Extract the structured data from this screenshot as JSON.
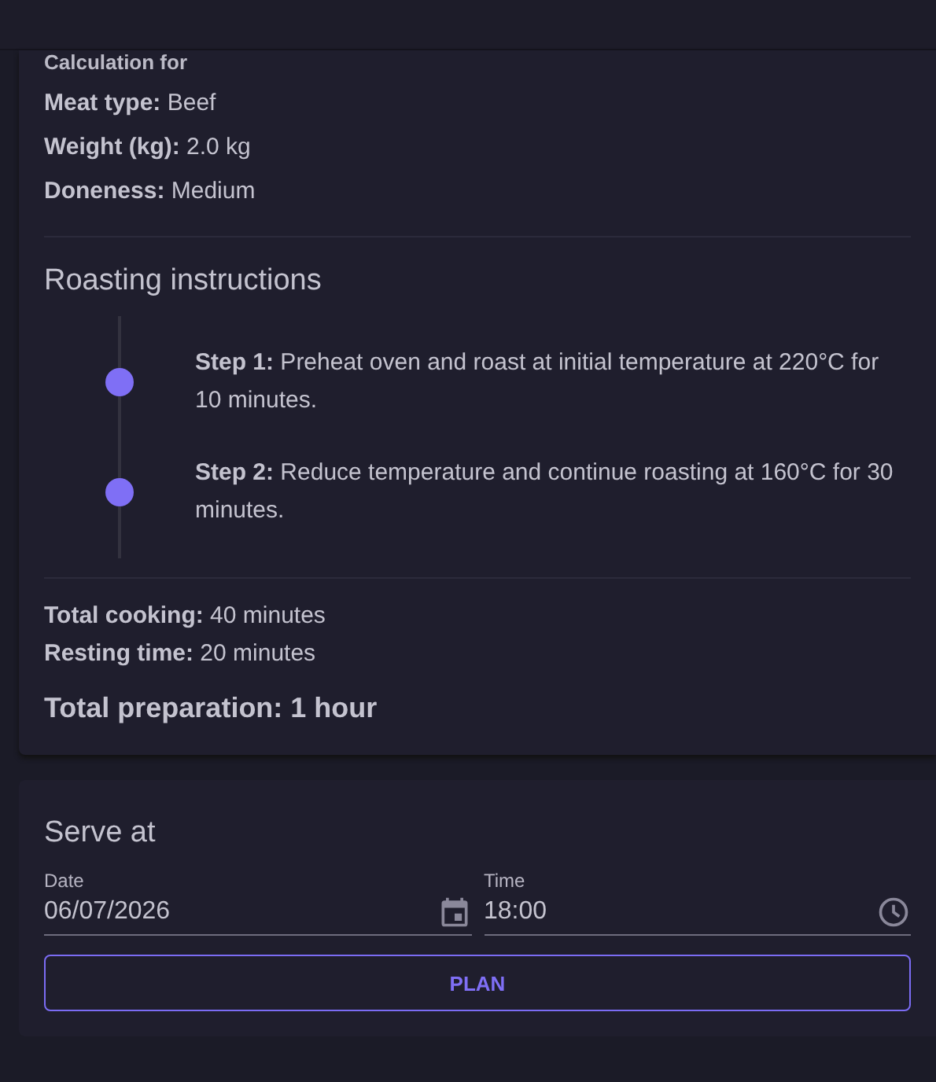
{
  "calculation": {
    "heading": "Calculation for",
    "facts": [
      "**Meat type:** Beef",
      "**Weight (kg):** 2.0 kg",
      "**Doneness:** Medium"
    ]
  },
  "instructions": {
    "title": "Roasting instructions",
    "steps": [
      "**Step 1:** Preheat oven and roast at initial temperature at 220°C for 10 minutes.",
      "**Step 2:** Reduce temperature and continue roasting at 160°C for 30 minutes."
    ]
  },
  "totals": [
    "**Total cooking:** 40 minutes",
    "**Resting time:** 20 minutes"
  ],
  "total_preparation": "Total preparation: 1 hour",
  "serve": {
    "title": "Serve at",
    "fields": [
      {
        "label": "Date",
        "value": "06/07/2026",
        "kind": "date"
      },
      {
        "label": "Time",
        "value": "18:00",
        "kind": "time"
      }
    ],
    "button": "PLAN"
  }
}
